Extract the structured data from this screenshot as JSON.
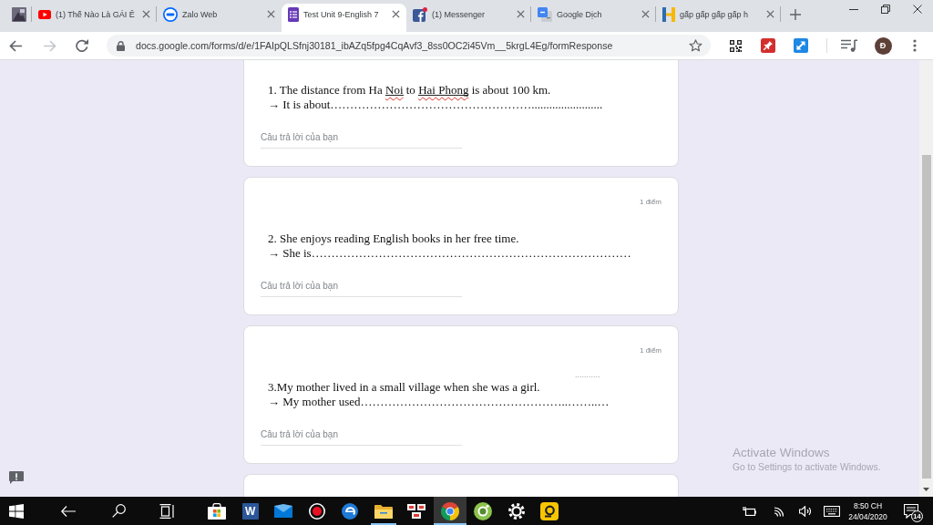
{
  "browser": {
    "tabs": [
      {
        "kind": "pinned",
        "selected": false
      },
      {
        "kind": "youtube",
        "title": "(1) Thế Nào Là GÁI Ê",
        "selected": false
      },
      {
        "kind": "zalo",
        "title": "Zalo Web",
        "selected": false
      },
      {
        "kind": "forms",
        "title": "Test Unit 9-English 7",
        "selected": true
      },
      {
        "kind": "facebook",
        "title": "(1) Messenger",
        "selected": false
      },
      {
        "kind": "translate",
        "title": "Google Dịch",
        "selected": false
      },
      {
        "kind": "letter",
        "title": "gấp gấp gấp gấp h",
        "selected": false
      }
    ],
    "back": {
      "disabled": false
    },
    "forward": {
      "disabled": true
    },
    "url": "docs.google.com/forms/d/e/1FAIpQLSfnj30181_ibAZq5fpg4CqAvf3_8ss0OC2i45Vm__5krgL4Eg/formResponse",
    "bookmarked": false,
    "profile": "Đ"
  },
  "form": {
    "questions": [
      {
        "question": [
          {
            "text": "1. The distance from Ha ",
            "misspelled": false
          },
          {
            "text": "Noi",
            "misspelled": true
          },
          {
            "text": " to ",
            "misspelled": false
          },
          {
            "text": "Hai Phong",
            "misspelled": true
          },
          {
            "text": " is about 100 km.",
            "misspelled": false
          }
        ],
        "prompt": "→ It is about……………………………………………........................",
        "placeholder": "Câu trả lời của bạn"
      },
      {
        "points": "1 điểm",
        "question": [
          {
            "text": "2. She enjoys reading English books in her free time.",
            "misspelled": false
          }
        ],
        "prompt": "→ She is………………………………………………………………………",
        "placeholder": "Câu trả lời của bạn"
      },
      {
        "points": "1 điểm",
        "stray_text": "...........",
        "question": [
          {
            "text": "3.My mother lived in a small village when she was a girl.",
            "misspelled": false
          }
        ],
        "prompt": "→ My mother used……………………………………………..……..…",
        "placeholder": "Câu trả lời của bạn"
      }
    ]
  },
  "notice": {
    "title": "Activate Windows",
    "text": "Go to Settings to activate Windows."
  },
  "taskbar": {
    "apps": [
      {
        "kind": "store",
        "running": false,
        "selected": false
      },
      {
        "kind": "word",
        "label": "W",
        "running": false,
        "selected": false
      },
      {
        "kind": "mail",
        "running": false,
        "selected": false
      },
      {
        "kind": "record",
        "running": false,
        "selected": false
      },
      {
        "kind": "edge",
        "running": false,
        "selected": false
      },
      {
        "kind": "folder",
        "running": true,
        "selected": false
      },
      {
        "kind": "tiles",
        "running": false,
        "selected": false
      },
      {
        "kind": "chrome",
        "running": true,
        "selected": true
      },
      {
        "kind": "swirl",
        "running": false,
        "selected": false
      },
      {
        "kind": "settings",
        "running": false,
        "selected": false
      },
      {
        "kind": "launcher",
        "running": false,
        "selected": false
      }
    ],
    "clock": {
      "time": "8:50 CH",
      "date": "24/04/2020"
    },
    "notifications": "14"
  }
}
